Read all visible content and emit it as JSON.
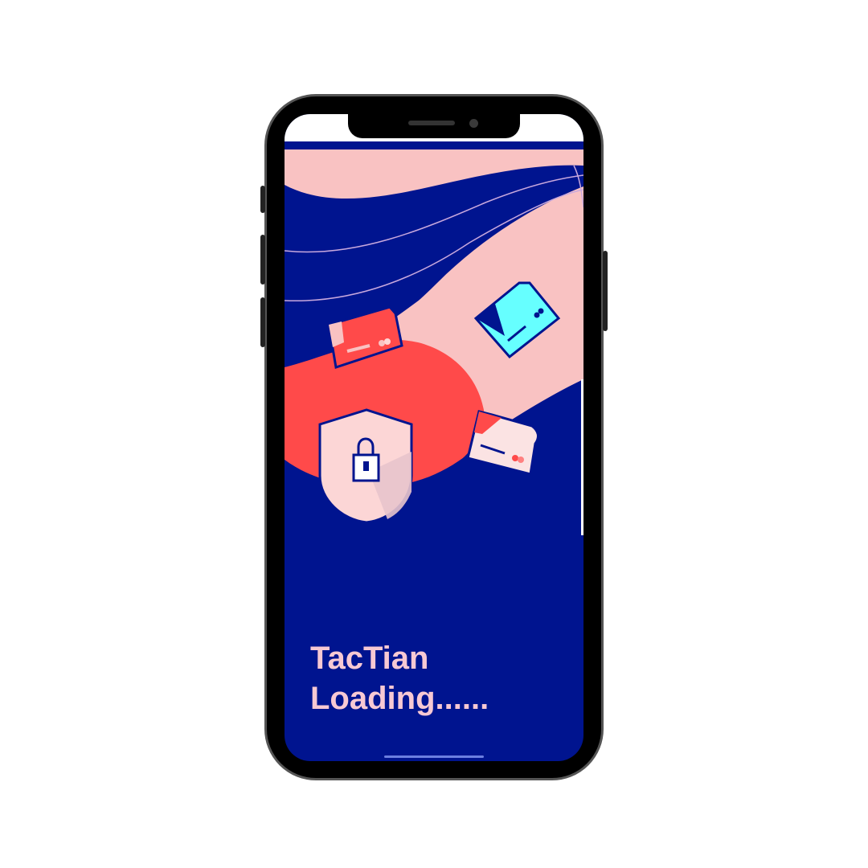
{
  "app": {
    "name": "TacTian",
    "status_text": "Loading......"
  },
  "colors": {
    "background": "#00148f",
    "pink": "#f9c2c2",
    "coral": "#ff4a4a",
    "cyan": "#66ffff",
    "text": "#f7c9d3"
  },
  "illustration": {
    "icons": [
      "shield-lock-icon",
      "credit-card-icon",
      "credit-card-icon",
      "credit-card-icon"
    ]
  }
}
